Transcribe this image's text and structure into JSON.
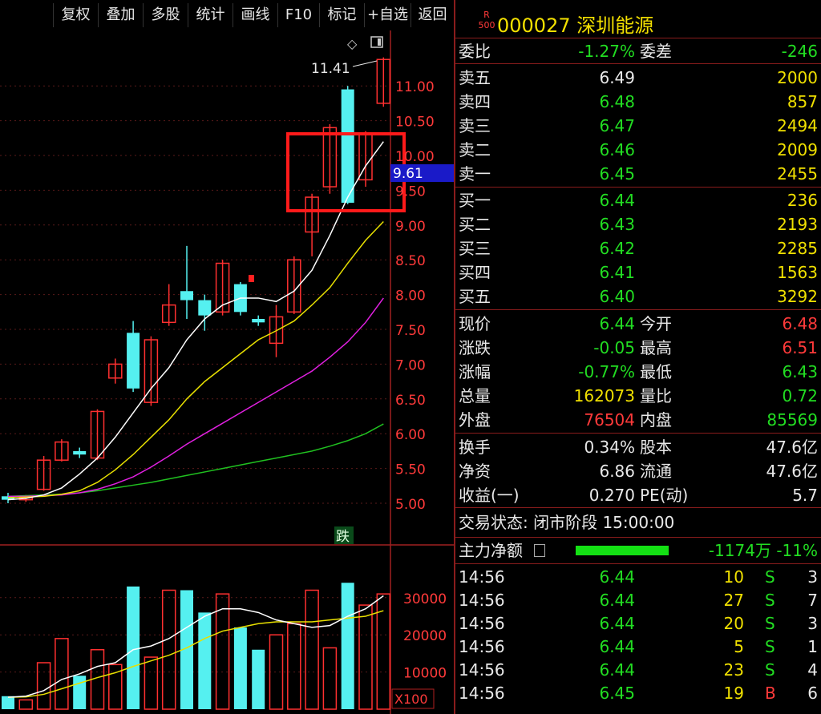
{
  "toolbar": {
    "buttons": [
      "复权",
      "叠加",
      "多股",
      "统计",
      "画线",
      "F10",
      "标记",
      "+自选",
      "返回"
    ]
  },
  "chart": {
    "high_label": "11.41",
    "current_price_tag": "9.61",
    "price_axis": [
      "11.00",
      "10.50",
      "10.00",
      "9.50",
      "9.00",
      "8.50",
      "8.00",
      "7.50",
      "7.00",
      "6.50",
      "6.00",
      "5.50",
      "5.00"
    ],
    "down_badge": "跌",
    "volume_axis": [
      "30000",
      "20000",
      "10000"
    ],
    "volume_unit": "X100",
    "colors": {
      "up": "#ff3030",
      "down": "#55f0f0",
      "ma5": "#ffffff",
      "ma10": "#e8e000",
      "ma20": "#e020e0",
      "ma60": "#20c020",
      "highlight": "#ff1a1a"
    }
  },
  "chart_data": {
    "type": "candlestick",
    "price_ylim": [
      5.0,
      11.41
    ],
    "candles": [
      {
        "o": 5.1,
        "c": 5.05,
        "h": 5.15,
        "l": 5.0
      },
      {
        "o": 5.05,
        "c": 5.08,
        "h": 5.12,
        "l": 5.02
      },
      {
        "o": 5.2,
        "c": 5.62,
        "h": 5.68,
        "l": 5.18
      },
      {
        "o": 5.62,
        "c": 5.88,
        "h": 5.92,
        "l": 5.6
      },
      {
        "o": 5.75,
        "c": 5.7,
        "h": 5.8,
        "l": 5.65
      },
      {
        "o": 5.65,
        "c": 6.32,
        "h": 6.35,
        "l": 5.62
      },
      {
        "o": 6.8,
        "c": 7.0,
        "h": 7.08,
        "l": 6.72
      },
      {
        "o": 7.45,
        "c": 6.65,
        "h": 7.62,
        "l": 6.6
      },
      {
        "o": 6.45,
        "c": 7.35,
        "h": 7.4,
        "l": 6.4
      },
      {
        "o": 7.6,
        "c": 7.85,
        "h": 8.15,
        "l": 7.55
      },
      {
        "o": 8.05,
        "c": 7.92,
        "h": 8.7,
        "l": 7.65
      },
      {
        "o": 7.92,
        "c": 7.7,
        "h": 8.0,
        "l": 7.48
      },
      {
        "o": 7.75,
        "c": 8.45,
        "h": 8.5,
        "l": 7.7
      },
      {
        "o": 8.15,
        "c": 7.75,
        "h": 8.18,
        "l": 7.7
      },
      {
        "o": 7.65,
        "c": 7.6,
        "h": 7.7,
        "l": 7.55
      },
      {
        "o": 7.3,
        "c": 7.68,
        "h": 7.85,
        "l": 7.1
      },
      {
        "o": 7.75,
        "c": 8.5,
        "h": 8.55,
        "l": 7.72
      },
      {
        "o": 8.9,
        "c": 9.4,
        "h": 9.45,
        "l": 8.55
      },
      {
        "o": 9.55,
        "c": 10.4,
        "h": 10.45,
        "l": 9.45
      },
      {
        "o": 10.95,
        "c": 9.32,
        "h": 11.0,
        "l": 9.3
      },
      {
        "o": 9.65,
        "c": 10.3,
        "h": 10.35,
        "l": 9.55
      },
      {
        "o": 10.75,
        "c": 11.38,
        "h": 11.41,
        "l": 10.7
      }
    ],
    "ma5": [
      5.05,
      5.07,
      5.12,
      5.22,
      5.42,
      5.65,
      5.95,
      6.3,
      6.65,
      6.95,
      7.35,
      7.65,
      7.85,
      7.95,
      7.95,
      7.9,
      8.05,
      8.35,
      8.85,
      9.4,
      9.85,
      10.2
    ],
    "ma10": [
      5.08,
      5.09,
      5.1,
      5.13,
      5.18,
      5.3,
      5.48,
      5.7,
      5.95,
      6.2,
      6.5,
      6.75,
      6.95,
      7.15,
      7.35,
      7.48,
      7.62,
      7.85,
      8.1,
      8.45,
      8.78,
      9.05
    ],
    "ma20": [
      5.1,
      5.1,
      5.11,
      5.12,
      5.15,
      5.2,
      5.28,
      5.38,
      5.52,
      5.68,
      5.85,
      6.0,
      6.15,
      6.3,
      6.45,
      6.6,
      6.75,
      6.9,
      7.1,
      7.32,
      7.6,
      7.95
    ],
    "ma60": [
      5.1,
      5.11,
      5.12,
      5.13,
      5.15,
      5.18,
      5.22,
      5.26,
      5.3,
      5.35,
      5.4,
      5.45,
      5.5,
      5.55,
      5.6,
      5.65,
      5.7,
      5.75,
      5.82,
      5.9,
      6.0,
      6.14
    ],
    "volume_ylim": [
      0,
      35000
    ],
    "volumes": [
      3500,
      2500,
      12500,
      19000,
      9000,
      16000,
      12000,
      33000,
      14000,
      32000,
      32000,
      26000,
      31000,
      22000,
      16000,
      20000,
      23000,
      32000,
      16500,
      34000,
      28000,
      31000
    ],
    "vol_ma5": [
      3200,
      3500,
      5000,
      8000,
      9500,
      11500,
      12500,
      16000,
      17000,
      19000,
      22000,
      25000,
      27000,
      27000,
      26000,
      24000,
      23000,
      22000,
      22500,
      25000,
      27000,
      30500
    ],
    "vol_ma10": [
      3200,
      3300,
      4000,
      5500,
      7000,
      8500,
      9800,
      11500,
      13000,
      14500,
      16500,
      19000,
      21000,
      22000,
      23000,
      23500,
      23500,
      23500,
      24000,
      24500,
      25000,
      26500
    ]
  },
  "quote": {
    "r_badge": "R",
    "r_badge_num": "500",
    "code_name": "000027 深圳能源",
    "weibi_label": "委比",
    "weibi_value": "-1.27%",
    "weicha_label": "委差",
    "weicha_value": "-246",
    "asks": [
      {
        "label": "卖五",
        "price": "6.49",
        "vol": "2000"
      },
      {
        "label": "卖四",
        "price": "6.48",
        "vol": "857"
      },
      {
        "label": "卖三",
        "price": "6.47",
        "vol": "2494"
      },
      {
        "label": "卖二",
        "price": "6.46",
        "vol": "2009"
      },
      {
        "label": "卖一",
        "price": "6.45",
        "vol": "2455"
      }
    ],
    "bids": [
      {
        "label": "买一",
        "price": "6.44",
        "vol": "236"
      },
      {
        "label": "买二",
        "price": "6.43",
        "vol": "2193"
      },
      {
        "label": "买三",
        "price": "6.42",
        "vol": "2285"
      },
      {
        "label": "买四",
        "price": "6.41",
        "vol": "1563"
      },
      {
        "label": "买五",
        "price": "6.40",
        "vol": "3292"
      }
    ],
    "stats": [
      {
        "l1": "现价",
        "v1": "6.44",
        "l2": "今开",
        "v2": "6.48"
      },
      {
        "l1": "涨跌",
        "v1": "-0.05",
        "l2": "最高",
        "v2": "6.51"
      },
      {
        "l1": "涨幅",
        "v1": "-0.77%",
        "l2": "最低",
        "v2": "6.43"
      },
      {
        "l1": "总量",
        "v1": "162073",
        "l2": "量比",
        "v2": "0.72"
      },
      {
        "l1": "外盘",
        "v1": "76504",
        "l2": "内盘",
        "v2": "85569"
      }
    ],
    "info": [
      {
        "l1": "换手",
        "v1": "0.34%",
        "l2": "股本",
        "v2": "47.6亿"
      },
      {
        "l1": "净资",
        "v1": "6.86",
        "l2": "流通",
        "v2": "47.6亿"
      },
      {
        "l1": "收益(一)",
        "v1": "0.270",
        "l2": "PE(动)",
        "v2": "5.7"
      }
    ],
    "trade_status": "交易状态: 闭市阶段 15:00:00",
    "main_flow_label": "主力净额",
    "main_flow_value": "-1174万 -11%",
    "main_flow_fraction": 0.11,
    "ticks": [
      {
        "t": "14:56",
        "p": "6.44",
        "v": "10",
        "s": "S",
        "n": "3"
      },
      {
        "t": "14:56",
        "p": "6.44",
        "v": "27",
        "s": "S",
        "n": "7"
      },
      {
        "t": "14:56",
        "p": "6.44",
        "v": "20",
        "s": "S",
        "n": "3"
      },
      {
        "t": "14:56",
        "p": "6.44",
        "v": "5",
        "s": "S",
        "n": "1"
      },
      {
        "t": "14:56",
        "p": "6.44",
        "v": "23",
        "s": "S",
        "n": "4"
      },
      {
        "t": "14:56",
        "p": "6.45",
        "v": "19",
        "s": "B",
        "n": "6"
      }
    ]
  }
}
